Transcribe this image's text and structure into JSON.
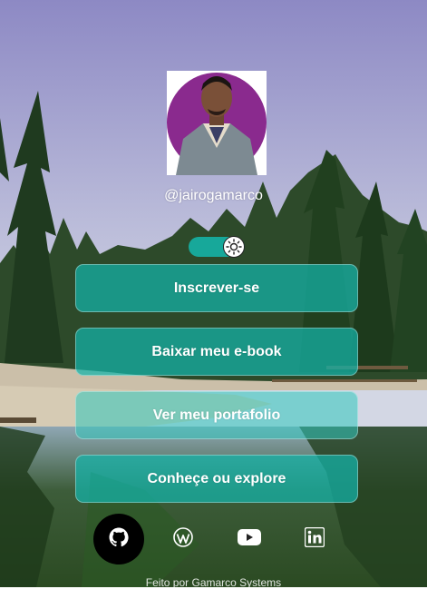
{
  "profile": {
    "handle": "@jairogamarco"
  },
  "theme_toggle": {
    "icon": "sun-icon",
    "state": "on"
  },
  "links": [
    {
      "label": "Inscrever-se"
    },
    {
      "label": "Baixar meu e-book"
    },
    {
      "label": "Ver meu portafolio"
    },
    {
      "label": "Conheçe ou explore"
    }
  ],
  "socials": [
    {
      "icon": "github-icon"
    },
    {
      "icon": "wordpress-icon"
    },
    {
      "icon": "youtube-icon"
    },
    {
      "icon": "linkedin-icon"
    }
  ],
  "footer": {
    "text": "Feito por Gamarco Systems"
  },
  "colors": {
    "button_bg": "#14b4aa",
    "toggle_bg": "#17a89a",
    "avatar_bg": "#8a2a8e",
    "github_bg": "#000000"
  }
}
